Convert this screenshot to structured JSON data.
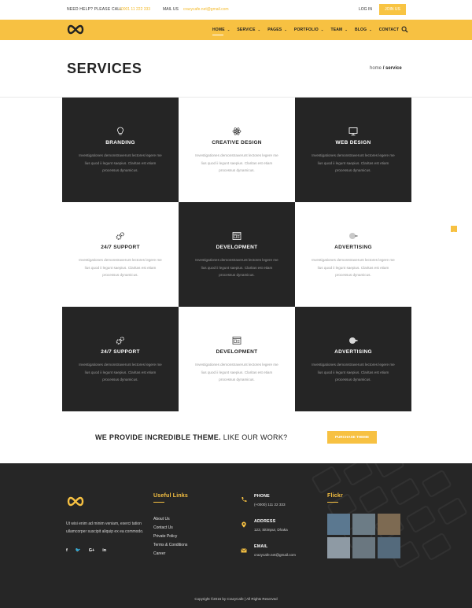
{
  "topbar": {
    "help": "NEED HELP? PLEASE CALL",
    "phone": "+0001 11 222 333",
    "mail_label": "MAIL US",
    "mail": "crazycafe.net@gmail.com",
    "login": "LOG IN",
    "join": "JOIN US"
  },
  "nav": {
    "items": [
      {
        "label": "HOME"
      },
      {
        "label": "SERVICE"
      },
      {
        "label": "PAGES"
      },
      {
        "label": "PORTFOLIO"
      },
      {
        "label": "TEAM"
      },
      {
        "label": "BLOG"
      },
      {
        "label": "CONTACT"
      }
    ],
    "caret": "⌄"
  },
  "page": {
    "title": "SERVICES",
    "breadcrumb_home": "home",
    "breadcrumb_current": "/ service"
  },
  "services": [
    {
      "title": "BRANDING",
      "text": "Investigationes demonstraverunt lectores legere me lius quod ii legunt saepius. Claritas est etiam processus dynamicus.",
      "icon": "lightbulb-icon",
      "theme": "dark"
    },
    {
      "title": "CREATIVE DESIGN",
      "text": "Investigationes demonstraverunt lectores legere me lius quod ii legunt saepius. Claritas est etiam processus dynamicus.",
      "icon": "atom-icon",
      "theme": "light"
    },
    {
      "title": "WEB DESIGN",
      "text": "Investigationes demonstraverunt lectores legere me lius quod ii legunt saepius. Claritas est etiam processus dynamicus.",
      "icon": "monitor-icon",
      "theme": "dark"
    },
    {
      "title": "24/7 SUPPORT",
      "text": "Investigationes demonstraverunt lectores legere me lius quod ii legunt saepius. Claritas est etiam processus dynamicus.",
      "icon": "gears-icon",
      "theme": "light"
    },
    {
      "title": "DEVELOPMENT",
      "text": "Investigationes demonstraverunt lectores legere me lius quod ii legunt saepius. Claritas est etiam processus dynamicus.",
      "icon": "browser-icon",
      "theme": "dark"
    },
    {
      "title": "ADVERTISING",
      "text": "Investigationes demonstraverunt lectores legere me lius quod ii legunt saepius. Claritas est etiam processus dynamicus.",
      "icon": "megaphone-icon",
      "theme": "light"
    },
    {
      "title": "24/7 SUPPORT",
      "text": "Investigationes demonstraverunt lectores legere me lius quod ii legunt saepius. Claritas est etiam processus dynamicus.",
      "icon": "gears-icon",
      "theme": "dark"
    },
    {
      "title": "DEVELOPMENT",
      "text": "Investigationes demonstraverunt lectores legere me lius quod ii legunt saepius. Claritas est etiam processus dynamicus.",
      "icon": "browser-icon",
      "theme": "light"
    },
    {
      "title": "ADVERTISING",
      "text": "Investigationes demonstraverunt lectores legere me lius quod ii legunt saepius. Claritas est etiam processus dynamicus.",
      "icon": "megaphone-icon",
      "theme": "dark"
    }
  ],
  "cta": {
    "text_bold": "WE PROVIDE INCREDIBLE THEME.",
    "text_normal": "LIKE OUR WORK?",
    "button": "PURCHASE THEME"
  },
  "footer": {
    "about": "Ut wisi enim ad minim veniam, exerci tation ullamcorper suscipit aliquip ex ea commodo.",
    "social": [
      "f",
      "🐦",
      "G+",
      "in"
    ],
    "useful_links_title": "Useful Links",
    "links": [
      "About Us",
      "Contact Us",
      "Private Policy",
      "Terms & Conditions",
      "Career"
    ],
    "phone_label": "PHONE",
    "phone_value": "(+0000) 111 22 333",
    "address_label": "ADDRESS",
    "address_value": "123, Sitimpur, Dhaka",
    "email_label": "EMAIL",
    "email_value": "crazycafe.net@gmail.com",
    "flickr_title": "Flickr",
    "copyright": "Copyright ©2016 by CrazyCafe  |  All Rights Reserved"
  },
  "colors": {
    "accent": "#f7c142",
    "dark": "#252525"
  }
}
